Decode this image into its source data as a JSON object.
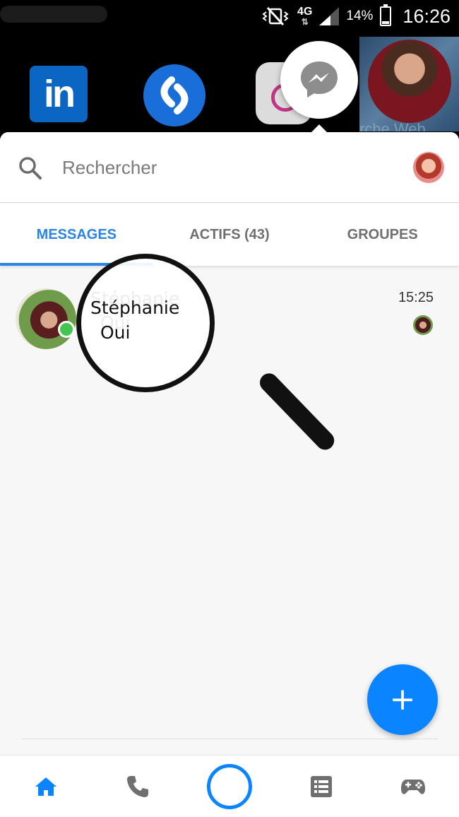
{
  "status_bar": {
    "network": "4G",
    "battery_percent": "14%",
    "time": "16:26"
  },
  "launcher": {
    "linkedin_label": "in",
    "background_text": "rche Web"
  },
  "search": {
    "placeholder": "Rechercher"
  },
  "tabs": [
    {
      "label": "MESSAGES",
      "active": true
    },
    {
      "label": "ACTIFS (43)",
      "active": false
    },
    {
      "label": "GROUPES",
      "active": false
    }
  ],
  "conversations": [
    {
      "name": "Stéphanie",
      "preview": "Oui",
      "time": "15:25",
      "online": true
    }
  ],
  "fab": {
    "icon": "plus-icon",
    "symbol": "+"
  },
  "bottom_nav": [
    {
      "icon": "home-icon",
      "active": true
    },
    {
      "icon": "phone-icon",
      "active": false
    },
    {
      "icon": "camera-ring-icon",
      "active": false
    },
    {
      "icon": "list-icon",
      "active": false
    },
    {
      "icon": "gamepad-icon",
      "active": false
    }
  ],
  "colors": {
    "accent": "#2a84e8",
    "fab": "#0a84ff",
    "online": "#42c64f",
    "inactive_tab": "#6f6f6f"
  }
}
